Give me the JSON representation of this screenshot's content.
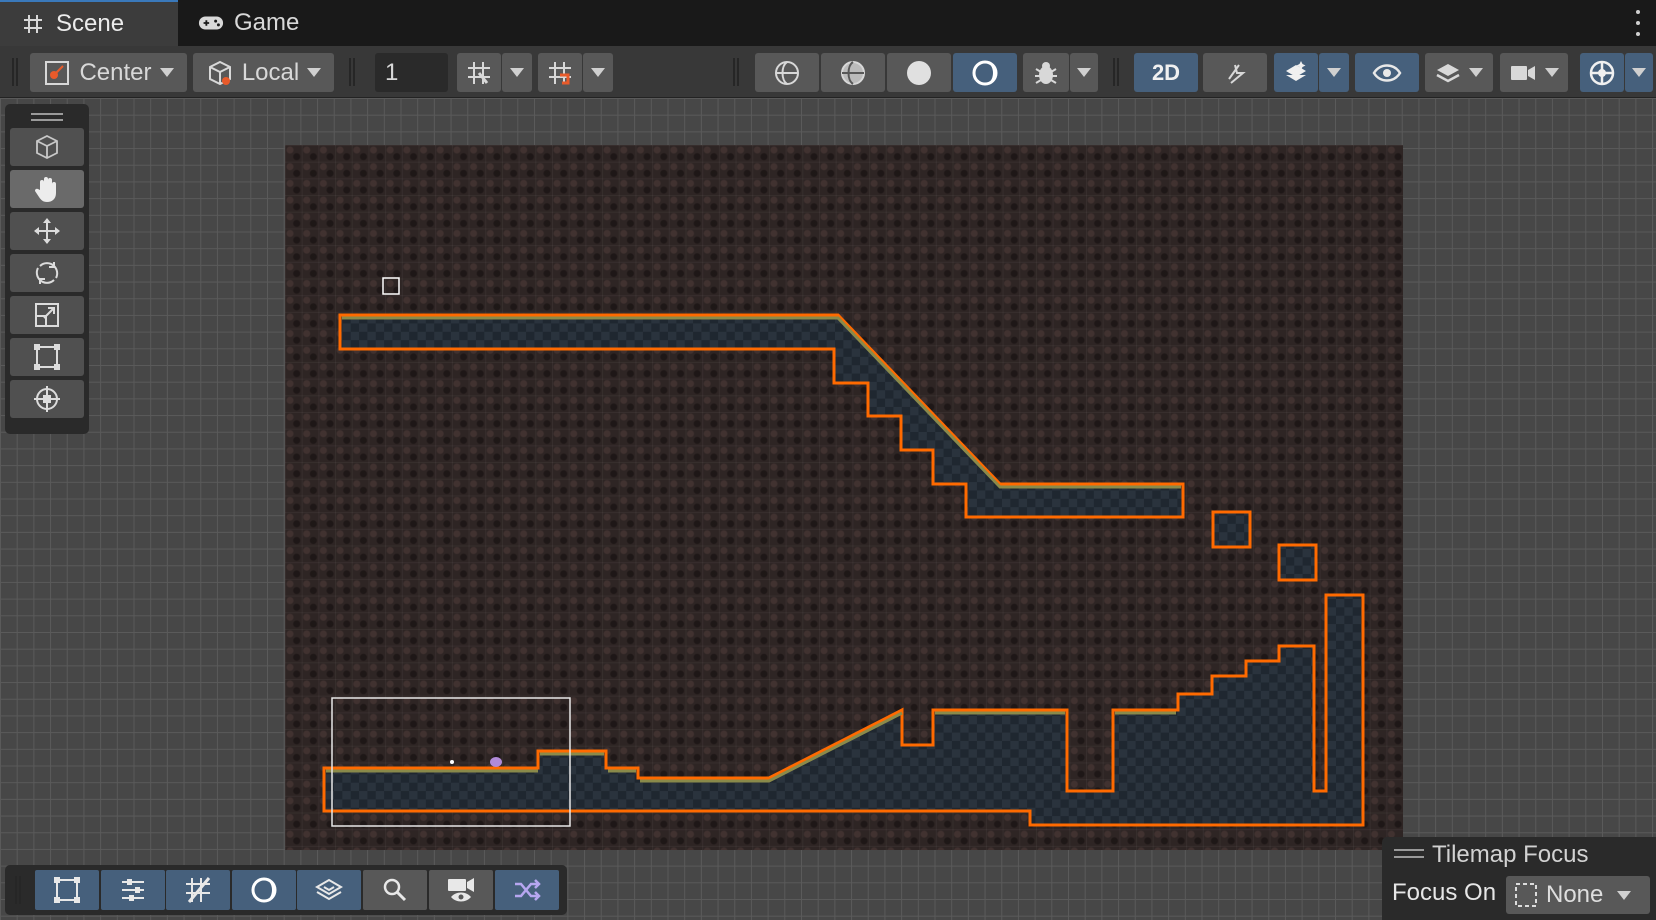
{
  "tabs": [
    {
      "label": "Scene",
      "icon": "grid-hash-icon",
      "active": true
    },
    {
      "label": "Game",
      "icon": "gamepad-icon",
      "active": false
    }
  ],
  "toolbar": {
    "pivot_mode": "Center",
    "pivot_rotation": "Local",
    "grid_increment": "1",
    "mode_2d_label": "2D"
  },
  "tools": [
    "view-tool",
    "hand-tool",
    "move-tool",
    "rotate-tool",
    "scale-tool",
    "rect-tool",
    "transform-tool"
  ],
  "tilemap_focus": {
    "title": "Tilemap Focus",
    "focus_label": "Focus On",
    "focus_value": "None"
  },
  "colors": {
    "accent_blue": "#46607c",
    "outline_orange": "#ff6a00",
    "tile_dark": "#1f2730"
  }
}
